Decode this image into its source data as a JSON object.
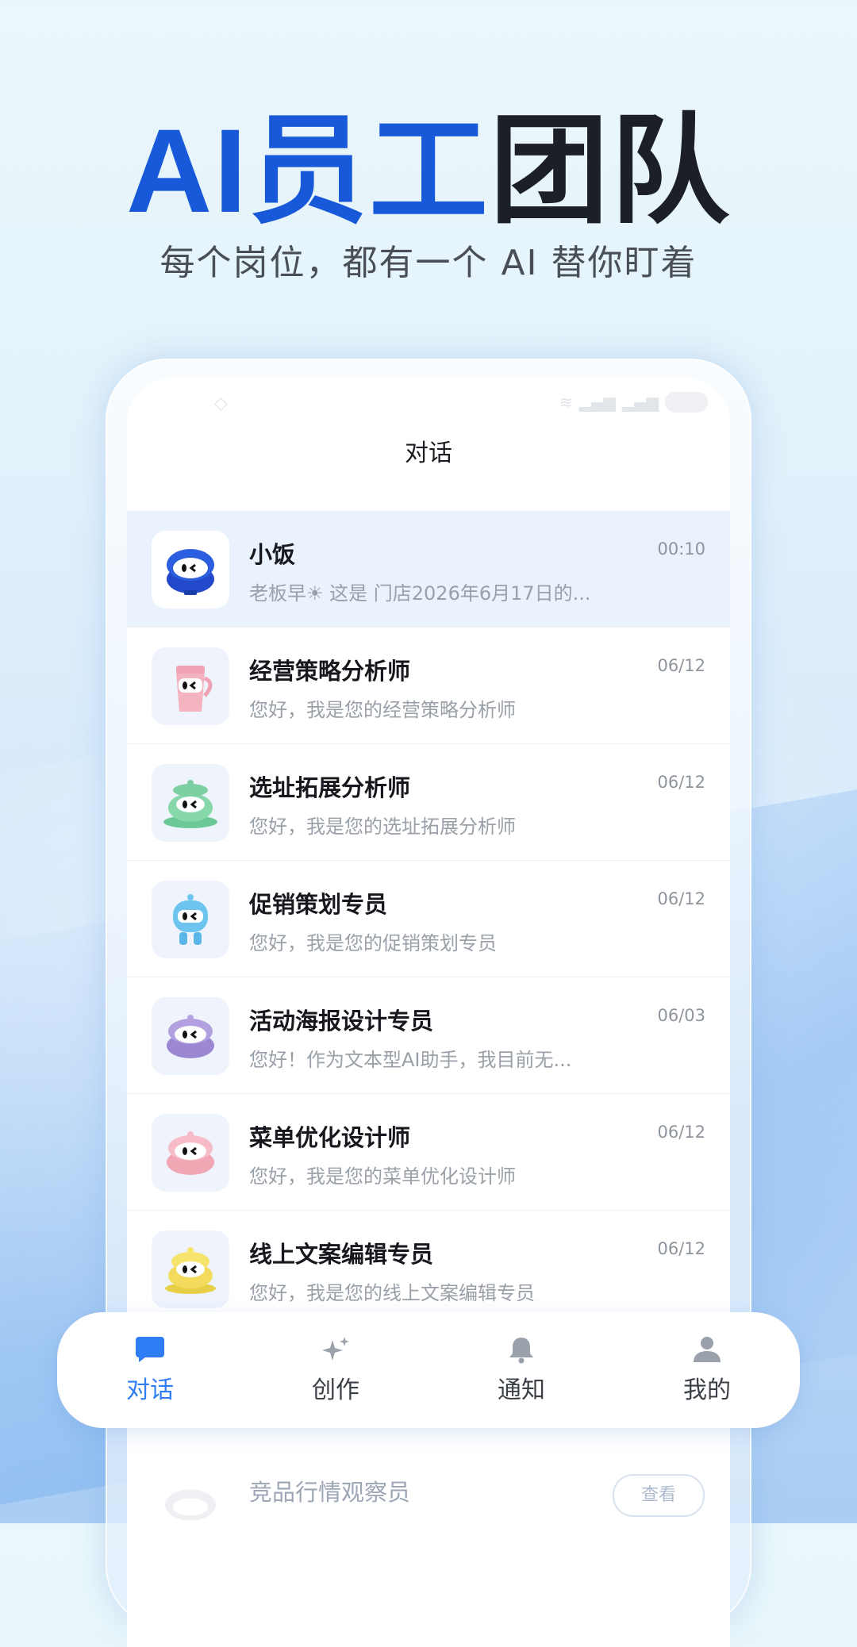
{
  "hero": {
    "title_blue": "AI员工",
    "title_dark": "团队",
    "subtitle": "每个岗位，都有一个 AI 替你盯着"
  },
  "screen": {
    "title": "对话"
  },
  "conversations": [
    {
      "name": "小饭",
      "preview": "老板早☀ 这是 门店2026年6月17日的...",
      "time": "00:10",
      "avatar": "blue-bowl-mascot",
      "color": "#2149c9"
    },
    {
      "name": "经营策略分析师",
      "preview": "您好，我是您的经营策略分析师",
      "time": "06/12",
      "avatar": "pink-coffee-pot-mascot",
      "color": "#f2a7b4"
    },
    {
      "name": "选址拓展分析师",
      "preview": "您好，我是您的选址拓展分析师",
      "time": "06/12",
      "avatar": "green-teapot-mascot",
      "color": "#7fd3a6"
    },
    {
      "name": "促销策划专员",
      "preview": "您好，我是您的促销策划专员",
      "time": "06/12",
      "avatar": "cyan-robot-mascot",
      "color": "#6cc4ef"
    },
    {
      "name": "活动海报设计专员",
      "preview": "您好！作为文本型AI助手，我目前无...",
      "time": "06/03",
      "avatar": "purple-bowl-mascot",
      "color": "#a793d8"
    },
    {
      "name": "菜单优化设计师",
      "preview": "您好，我是您的菜单优化设计师",
      "time": "06/12",
      "avatar": "pink-bowl-mascot",
      "color": "#f5b3bf"
    },
    {
      "name": "线上文案编辑专员",
      "preview": "您好，我是您的线上文案编辑专员",
      "time": "06/12",
      "avatar": "yellow-bowl-mascot",
      "color": "#f3dc5d"
    }
  ],
  "under_row": {
    "name": "竞品行情观察员",
    "button": "查看"
  },
  "tabs": [
    {
      "label": "对话",
      "icon": "chat-bubble-icon",
      "active": true
    },
    {
      "label": "创作",
      "icon": "sparkle-icon",
      "active": false
    },
    {
      "label": "通知",
      "icon": "bell-icon",
      "active": false
    },
    {
      "label": "我的",
      "icon": "person-icon",
      "active": false
    }
  ],
  "colors": {
    "brand_blue": "#1859d9",
    "active_tab": "#2f7df5"
  }
}
